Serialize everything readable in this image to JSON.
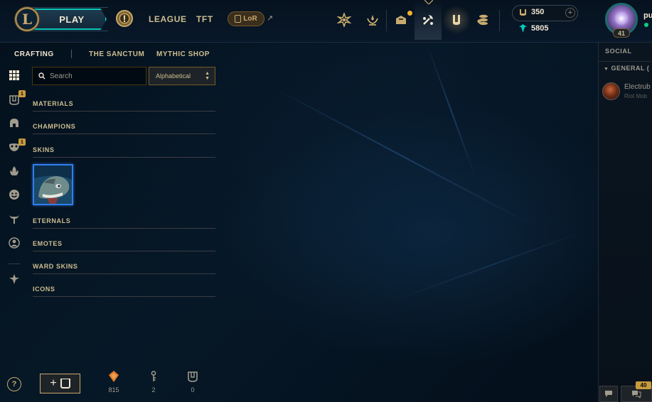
{
  "topbar": {
    "play_label": "PLAY",
    "alert_glyph": "!",
    "links": [
      {
        "label": "LEAGUE"
      },
      {
        "label": "TFT"
      }
    ],
    "lor_label": "LoR",
    "external_glyph": "↗",
    "nav_icons": [
      {
        "name": "home-icon"
      },
      {
        "name": "profile-icon"
      },
      {
        "name": "collection-icon"
      },
      {
        "name": "loot-icon"
      },
      {
        "name": "clash-icon"
      },
      {
        "name": "store-icon"
      }
    ],
    "currency": {
      "blue_essence": "350",
      "riot_points": "5805",
      "plus_glyph": "+"
    },
    "profile": {
      "level": "41",
      "username": "pu"
    }
  },
  "subnav": {
    "items": [
      {
        "label": "CRAFTING",
        "active": true
      },
      {
        "label": "THE SANCTUM",
        "active": false
      },
      {
        "label": "MYTHIC SHOP",
        "active": false
      }
    ]
  },
  "rail": {
    "items": [
      {
        "name": "grid-icon",
        "badge": ""
      },
      {
        "name": "chest-icon",
        "badge": "1"
      },
      {
        "name": "helmet-icon",
        "badge": ""
      },
      {
        "name": "mask-icon",
        "badge": "1"
      },
      {
        "name": "flame-icon",
        "badge": ""
      },
      {
        "name": "emote-icon",
        "badge": ""
      },
      {
        "name": "ward-icon",
        "badge": ""
      },
      {
        "name": "profile-icon",
        "badge": ""
      },
      {
        "name": "tft-icon",
        "badge": ""
      }
    ]
  },
  "filters": {
    "search_placeholder": "Search",
    "sort_value": "Alphabetical"
  },
  "categories": [
    {
      "label": "MATERIALS"
    },
    {
      "label": "CHAMPIONS"
    },
    {
      "label": "SKINS"
    },
    {
      "label": "ETERNALS"
    },
    {
      "label": "EMOTES"
    },
    {
      "label": "WARD SKINS"
    },
    {
      "label": "ICONS"
    }
  ],
  "bottom": {
    "help_glyph": "?",
    "add_glyph": "+",
    "resources": [
      {
        "name": "orange-essence-icon",
        "value": "815"
      },
      {
        "name": "key-icon",
        "value": "2"
      },
      {
        "name": "chest-icon",
        "value": "0"
      }
    ]
  },
  "social": {
    "title": "SOCIAL",
    "group_label": "GENERAL (",
    "friends": [
      {
        "name": "Electrub",
        "status": "Riot Mob"
      }
    ],
    "chat_count": "40"
  },
  "colors": {
    "gold": "#c8aa6e",
    "gold_light": "#cdbe91",
    "teal": "#0ac8b9",
    "skin_border": "#2f7ef0",
    "badge": "#c89b3c",
    "background": "#010a13"
  }
}
